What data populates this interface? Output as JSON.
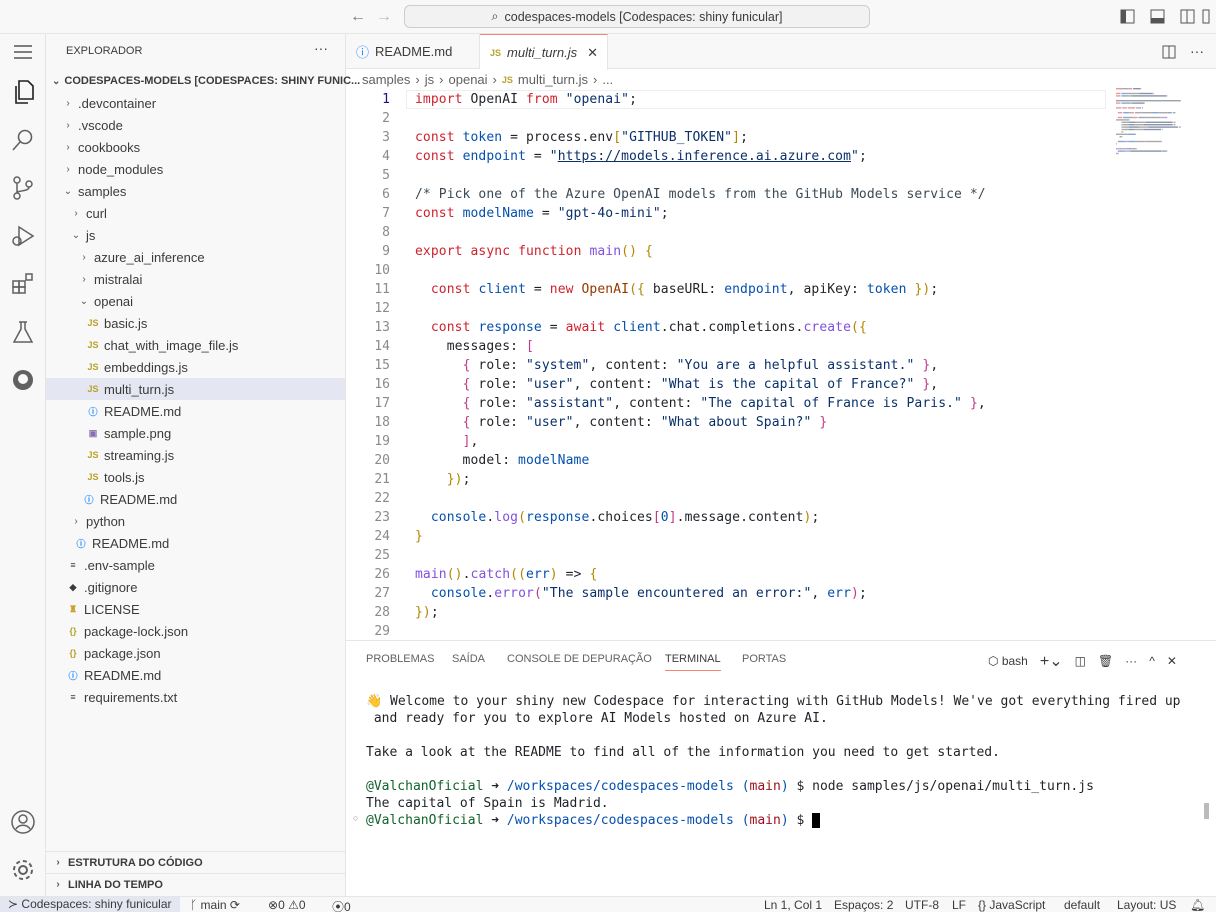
{
  "titlebar": {
    "command_center": "codespaces-models [Codespaces: shiny funicular]"
  },
  "sidebar": {
    "title": "EXPLORADOR",
    "root": "CODESPACES-MODELS [CODESPACES: SHINY FUNIC...",
    "items": [
      {
        "label": ".devcontainer",
        "type": "folder",
        "open": false,
        "depth": 0
      },
      {
        "label": ".vscode",
        "type": "folder",
        "open": false,
        "depth": 0
      },
      {
        "label": "cookbooks",
        "type": "folder",
        "open": false,
        "depth": 0
      },
      {
        "label": "node_modules",
        "type": "folder",
        "open": false,
        "depth": 0
      },
      {
        "label": "samples",
        "type": "folder",
        "open": true,
        "depth": 0
      },
      {
        "label": "curl",
        "type": "folder",
        "open": false,
        "depth": 1
      },
      {
        "label": "js",
        "type": "folder",
        "open": true,
        "depth": 1
      },
      {
        "label": "azure_ai_inference",
        "type": "folder",
        "open": false,
        "depth": 2
      },
      {
        "label": "mistralai",
        "type": "folder",
        "open": false,
        "depth": 2
      },
      {
        "label": "openai",
        "type": "folder",
        "open": true,
        "depth": 2
      },
      {
        "label": "basic.js",
        "type": "js",
        "depth": 3
      },
      {
        "label": "chat_with_image_file.js",
        "type": "js",
        "depth": 3
      },
      {
        "label": "embeddings.js",
        "type": "js",
        "depth": 3
      },
      {
        "label": "multi_turn.js",
        "type": "js",
        "depth": 3,
        "selected": true
      },
      {
        "label": "README.md",
        "type": "info",
        "depth": 3
      },
      {
        "label": "sample.png",
        "type": "image",
        "depth": 3
      },
      {
        "label": "streaming.js",
        "type": "js",
        "depth": 3
      },
      {
        "label": "tools.js",
        "type": "js",
        "depth": 3
      },
      {
        "label": "README.md",
        "type": "info",
        "depth": 2.5
      },
      {
        "label": "python",
        "type": "folder",
        "open": false,
        "depth": 1
      },
      {
        "label": "README.md",
        "type": "info",
        "depth": 1.5
      },
      {
        "label": ".env-sample",
        "type": "lines",
        "depth": 0.5
      },
      {
        "label": ".gitignore",
        "type": "git",
        "depth": 0.5
      },
      {
        "label": "LICENSE",
        "type": "license",
        "depth": 0.5
      },
      {
        "label": "package-lock.json",
        "type": "json",
        "depth": 0.5
      },
      {
        "label": "package.json",
        "type": "json",
        "depth": 0.5
      },
      {
        "label": "README.md",
        "type": "info",
        "depth": 0.5
      },
      {
        "label": "requirements.txt",
        "type": "lines",
        "depth": 0.5
      }
    ],
    "sections": [
      "ESTRUTURA DO CÓDIGO",
      "LINHA DO TEMPO"
    ]
  },
  "tabs": [
    {
      "label": "README.md",
      "icon": "info"
    },
    {
      "label": "multi_turn.js",
      "icon": "JS",
      "active": true
    }
  ],
  "breadcrumbs": [
    "samples",
    "js",
    "openai",
    "multi_turn.js",
    "..."
  ],
  "editor": {
    "current_line": 1,
    "lines": [
      [
        [
          "k",
          "import"
        ],
        [
          "p",
          " OpenAI "
        ],
        [
          "k",
          "from"
        ],
        [
          "p",
          " "
        ],
        [
          "s",
          "\"openai\""
        ],
        [
          "p",
          ";"
        ]
      ],
      [],
      [
        [
          "k",
          "const"
        ],
        [
          "p",
          " "
        ],
        [
          "v",
          "token"
        ],
        [
          "p",
          " = process.env"
        ],
        [
          "b1",
          "["
        ],
        [
          "s",
          "\"GITHUB_TOKEN\""
        ],
        [
          "b1",
          "]"
        ],
        [
          "p",
          ";"
        ]
      ],
      [
        [
          "k",
          "const"
        ],
        [
          "p",
          " "
        ],
        [
          "v",
          "endpoint"
        ],
        [
          "p",
          " = "
        ],
        [
          "s",
          "\""
        ],
        [
          "su",
          "https://models.inference.ai.azure.com"
        ],
        [
          "s",
          "\""
        ],
        [
          "p",
          ";"
        ]
      ],
      [],
      [
        [
          "c",
          "/* Pick one of the Azure OpenAI models from the GitHub Models service */"
        ]
      ],
      [
        [
          "k",
          "const"
        ],
        [
          "p",
          " "
        ],
        [
          "v",
          "modelName"
        ],
        [
          "p",
          " = "
        ],
        [
          "s",
          "\"gpt-4o-mini\""
        ],
        [
          "p",
          ";"
        ]
      ],
      [],
      [
        [
          "k",
          "export"
        ],
        [
          "p",
          " "
        ],
        [
          "k",
          "async"
        ],
        [
          "p",
          " "
        ],
        [
          "k",
          "function"
        ],
        [
          "p",
          " "
        ],
        [
          "f",
          "main"
        ],
        [
          "b1",
          "()"
        ],
        [
          "p",
          " "
        ],
        [
          "b1",
          "{"
        ]
      ],
      [],
      [
        [
          "p",
          "  "
        ],
        [
          "k",
          "const"
        ],
        [
          "p",
          " "
        ],
        [
          "v",
          "client"
        ],
        [
          "p",
          " = "
        ],
        [
          "k",
          "new"
        ],
        [
          "p",
          " "
        ],
        [
          "o",
          "OpenAI"
        ],
        [
          "b1",
          "({"
        ],
        [
          "p",
          " baseURL: "
        ],
        [
          "v",
          "endpoint"
        ],
        [
          "p",
          ", apiKey: "
        ],
        [
          "v",
          "token"
        ],
        [
          "p",
          " "
        ],
        [
          "b1",
          "})"
        ],
        [
          "p",
          ";"
        ]
      ],
      [],
      [
        [
          "p",
          "  "
        ],
        [
          "k",
          "const"
        ],
        [
          "p",
          " "
        ],
        [
          "v",
          "response"
        ],
        [
          "p",
          " = "
        ],
        [
          "k",
          "await"
        ],
        [
          "p",
          " "
        ],
        [
          "v",
          "client"
        ],
        [
          "p",
          ".chat.completions."
        ],
        [
          "f",
          "create"
        ],
        [
          "b1",
          "({"
        ]
      ],
      [
        [
          "p",
          "    messages: "
        ],
        [
          "b2",
          "["
        ]
      ],
      [
        [
          "p",
          "      "
        ],
        [
          "b2",
          "{"
        ],
        [
          "p",
          " role: "
        ],
        [
          "s",
          "\"system\""
        ],
        [
          "p",
          ", content: "
        ],
        [
          "s",
          "\"You are a helpful assistant.\""
        ],
        [
          "p",
          " "
        ],
        [
          "b2",
          "}"
        ],
        [
          "p",
          ","
        ]
      ],
      [
        [
          "p",
          "      "
        ],
        [
          "b2",
          "{"
        ],
        [
          "p",
          " role: "
        ],
        [
          "s",
          "\"user\""
        ],
        [
          "p",
          ", content: "
        ],
        [
          "s",
          "\"What is the capital of France?\""
        ],
        [
          "p",
          " "
        ],
        [
          "b2",
          "}"
        ],
        [
          "p",
          ","
        ]
      ],
      [
        [
          "p",
          "      "
        ],
        [
          "b2",
          "{"
        ],
        [
          "p",
          " role: "
        ],
        [
          "s",
          "\"assistant\""
        ],
        [
          "p",
          ", content: "
        ],
        [
          "s",
          "\"The capital of France is Paris.\""
        ],
        [
          "p",
          " "
        ],
        [
          "b2",
          "}"
        ],
        [
          "p",
          ","
        ]
      ],
      [
        [
          "p",
          "      "
        ],
        [
          "b2",
          "{"
        ],
        [
          "p",
          " role: "
        ],
        [
          "s",
          "\"user\""
        ],
        [
          "p",
          ", content: "
        ],
        [
          "s",
          "\"What about Spain?\""
        ],
        [
          "p",
          " "
        ],
        [
          "b2",
          "}"
        ]
      ],
      [
        [
          "p",
          "      "
        ],
        [
          "b2",
          "]"
        ],
        [
          "p",
          ","
        ]
      ],
      [
        [
          "p",
          "      model: "
        ],
        [
          "v",
          "modelName"
        ]
      ],
      [
        [
          "p",
          "    "
        ],
        [
          "b1",
          "})"
        ],
        [
          "p",
          ";"
        ]
      ],
      [],
      [
        [
          "p",
          "  "
        ],
        [
          "v",
          "console"
        ],
        [
          "p",
          "."
        ],
        [
          "f",
          "log"
        ],
        [
          "b1",
          "("
        ],
        [
          "v",
          "response"
        ],
        [
          "p",
          ".choices"
        ],
        [
          "b2",
          "["
        ],
        [
          "n",
          "0"
        ],
        [
          "b2",
          "]"
        ],
        [
          "p",
          ".message.content"
        ],
        [
          "b1",
          ")"
        ],
        [
          "p",
          ";"
        ]
      ],
      [
        [
          "b1",
          "}"
        ]
      ],
      [],
      [
        [
          "f",
          "main"
        ],
        [
          "b1",
          "()"
        ],
        [
          "p",
          "."
        ],
        [
          "f",
          "catch"
        ],
        [
          "b1",
          "(("
        ],
        [
          "v",
          "err"
        ],
        [
          "b1",
          ")"
        ],
        [
          "p",
          " => "
        ],
        [
          "b1",
          "{"
        ]
      ],
      [
        [
          "p",
          "  "
        ],
        [
          "v",
          "console"
        ],
        [
          "p",
          "."
        ],
        [
          "f",
          "error"
        ],
        [
          "b2",
          "("
        ],
        [
          "s",
          "\"The sample encountered an error:\""
        ],
        [
          "p",
          ", "
        ],
        [
          "v",
          "err"
        ],
        [
          "b2",
          ")"
        ],
        [
          "p",
          ";"
        ]
      ],
      [
        [
          "b1",
          "})"
        ],
        [
          "p",
          ";"
        ]
      ],
      []
    ]
  },
  "panel": {
    "tabs": [
      "PROBLEMAS",
      "SAÍDA",
      "CONSOLE DE DEPURAÇÃO",
      "TERMINAL",
      "PORTAS"
    ],
    "active_tab": "TERMINAL",
    "shell": "bash",
    "terminal": {
      "welcome1": "👋 Welcome to your shiny new Codespace for interacting with GitHub Models! We've got everything fired up",
      "welcome2": " and ready for you to explore AI Models hosted on Azure AI.",
      "readme": "Take a look at the README to find all of the information you need to get started.",
      "user": "@ValchanOficial",
      "arrow": " ➜ ",
      "path": "/workspaces/codespaces-models",
      "branch": "main",
      "command": "node samples/js/openai/multi_turn.js",
      "output": "The capital of Spain is Madrid."
    }
  },
  "status": {
    "remote": "Codespaces: shiny funicular",
    "branch": "main",
    "errors": "0",
    "warnings": "0",
    "ports": "0",
    "position": "Ln 1, Col 1",
    "spaces": "Espaços: 2",
    "encoding": "UTF-8",
    "eol": "LF",
    "language": "JavaScript",
    "profile": "default",
    "layout": "Layout: US"
  }
}
